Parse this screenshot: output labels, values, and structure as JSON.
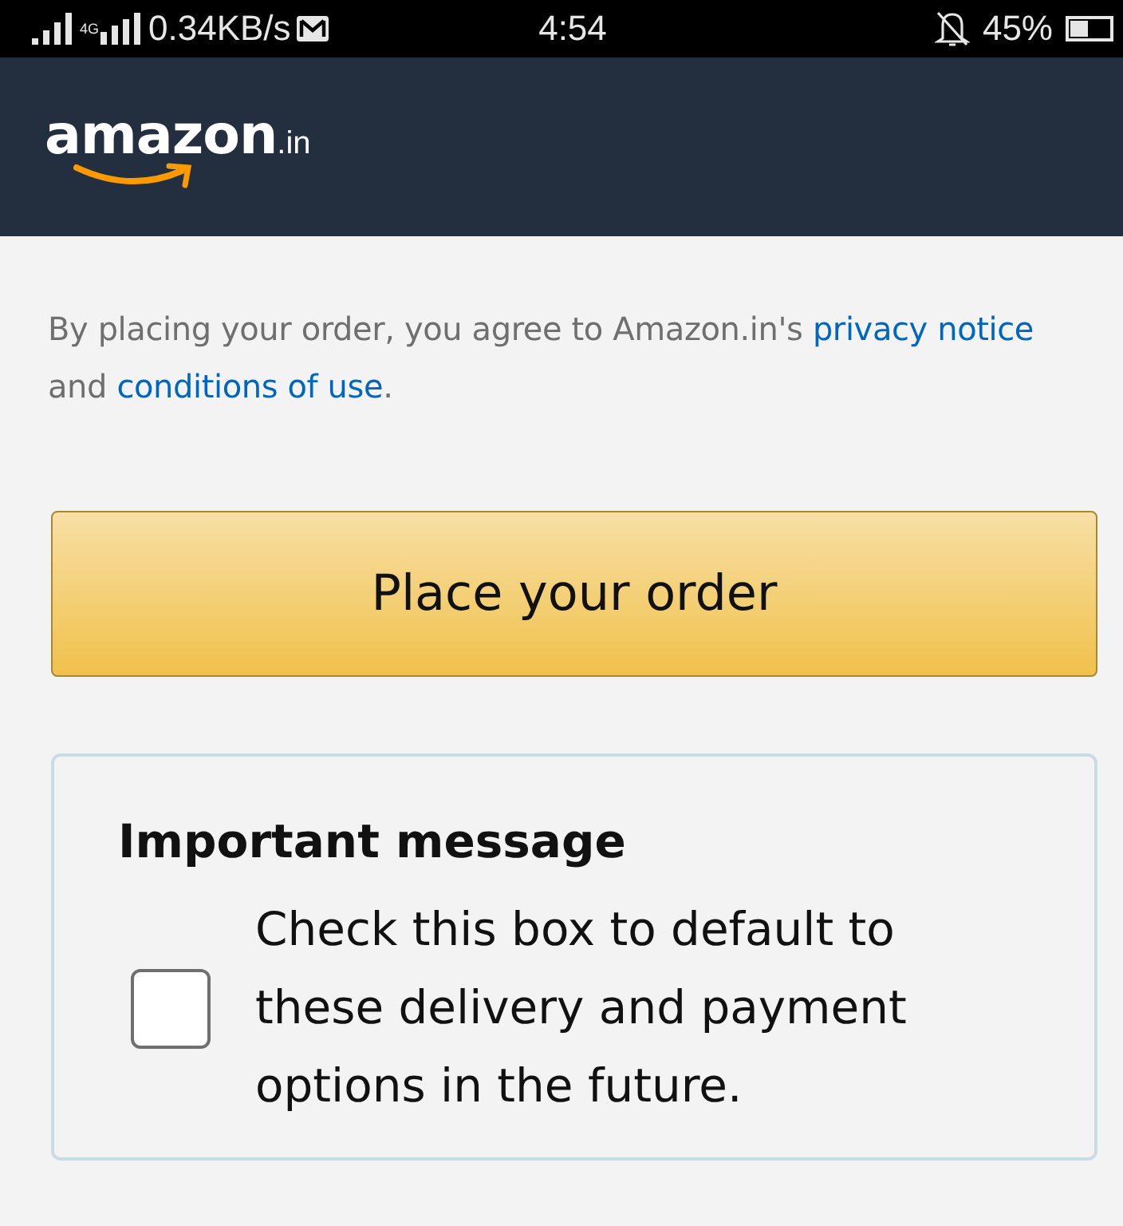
{
  "status_bar": {
    "network": "4G",
    "speed": "0.34KB/s",
    "time": "4:54",
    "battery": "45%"
  },
  "header": {
    "logo": "amazon",
    "logo_suffix": ".in"
  },
  "agreement": {
    "text": "By placing your order, you agree to Amazon.in's",
    "link1": "privacy notice",
    "middle": "and",
    "link2": "conditions of use",
    "end": "."
  },
  "place_order_button": "Place your order",
  "message": {
    "title": "Important message",
    "checked": false,
    "text": "Check this box to default to these delivery and payment options in the future."
  }
}
